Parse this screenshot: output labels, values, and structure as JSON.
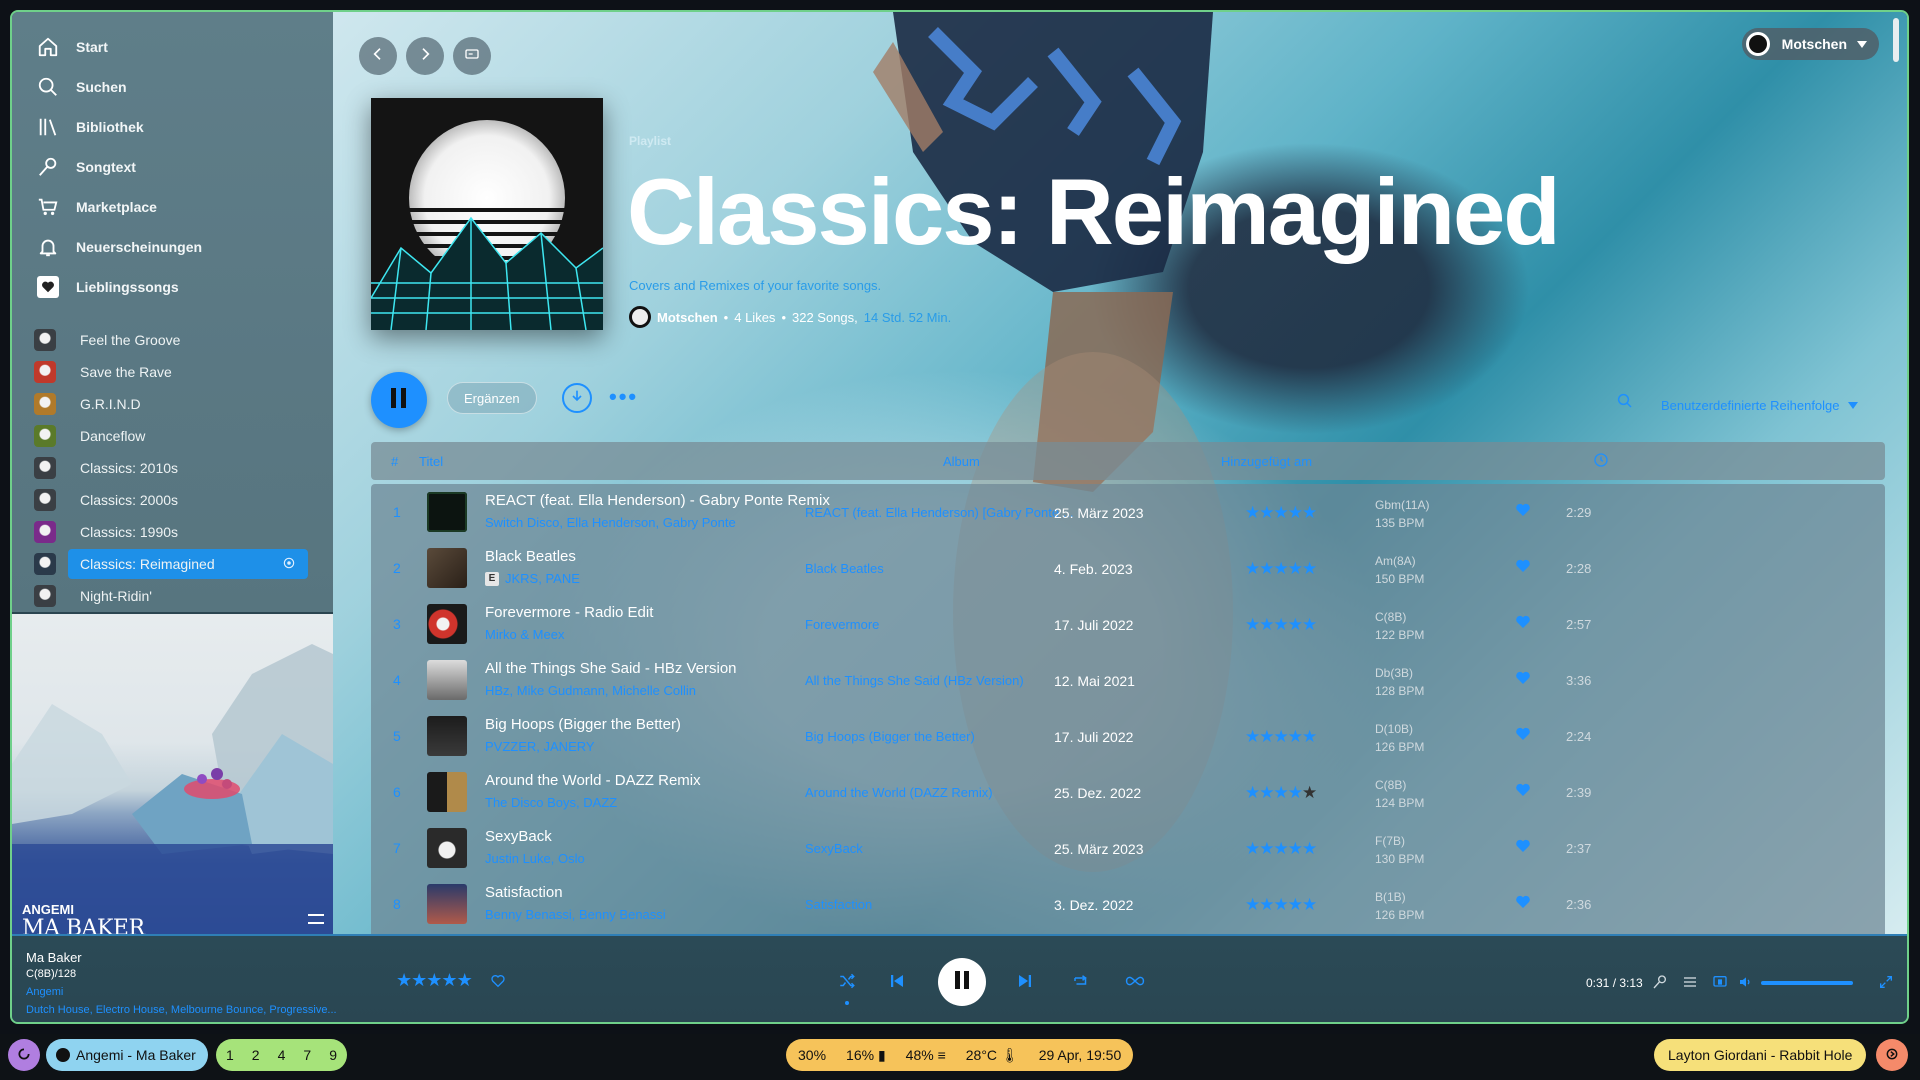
{
  "sidebar": {
    "nav": [
      {
        "label": "Start",
        "icon": "home-icon"
      },
      {
        "label": "Suchen",
        "icon": "search-icon"
      },
      {
        "label": "Bibliothek",
        "icon": "library-icon"
      },
      {
        "label": "Songtext",
        "icon": "microphone-icon"
      },
      {
        "label": "Marketplace",
        "icon": "cart-icon"
      },
      {
        "label": "Neuerscheinungen",
        "icon": "bell-icon"
      },
      {
        "label": "Lieblingssongs",
        "icon": "heart-icon"
      }
    ],
    "playlists": [
      {
        "label": "Feel the Groove"
      },
      {
        "label": "Save the Rave"
      },
      {
        "label": "G.R.I.N.D"
      },
      {
        "label": "Danceflow"
      },
      {
        "label": "Classics: 2010s"
      },
      {
        "label": "Classics: 2000s"
      },
      {
        "label": "Classics: 1990s"
      },
      {
        "label": "Classics: Reimagined",
        "active": true
      },
      {
        "label": "Night-Ridin'"
      }
    ],
    "art_artist": "ANGEMI",
    "art_title": "MA BAKER"
  },
  "header": {
    "user": "Motschen"
  },
  "playlist": {
    "type": "Playlist",
    "title": "Classics: Reimagined",
    "description": "Covers and Remixes of your favorite songs.",
    "owner": "Motschen",
    "likes": "4 Likes",
    "songs": "322 Songs,",
    "duration": "14 Std. 52 Min.",
    "add_label": "Ergänzen",
    "sort_label": "Benutzerdefinierte Reihenfolge"
  },
  "table": {
    "headers": {
      "num": "#",
      "title": "Titel",
      "album": "Album",
      "added": "Hinzugefügt am"
    },
    "rows": [
      {
        "num": "1",
        "title": "REACT (feat. Ella Henderson) - Gabry Ponte Remix",
        "artists": "Switch Disco, Ella Henderson, Gabry Ponte",
        "explicit": false,
        "album": "REACT (feat. Ella Henderson) [Gabry Ponte ...",
        "date": "25. März 2023",
        "rating": 5,
        "key": "Gbm(11A)",
        "bpm": "135 BPM",
        "duration": "2:29",
        "art": "react"
      },
      {
        "num": "2",
        "title": "Black Beatles",
        "artists": "JKRS, PANE",
        "explicit": true,
        "album": "Black Beatles",
        "date": "4. Feb. 2023",
        "rating": 5,
        "key": "Am(8A)",
        "bpm": "150 BPM",
        "duration": "2:28",
        "art": "beatles"
      },
      {
        "num": "3",
        "title": "Forevermore - Radio Edit",
        "artists": "Mirko & Meex",
        "explicit": false,
        "album": "Forevermore",
        "date": "17. Juli 2022",
        "rating": 5,
        "key": "C(8B)",
        "bpm": "122 BPM",
        "duration": "2:57",
        "art": "forever"
      },
      {
        "num": "4",
        "title": "All the Things She Said - HBz Version",
        "artists": "HBz, Mike Gudmann, Michelle Collin",
        "explicit": false,
        "album": "All the Things She Said (HBz Version)",
        "date": "12. Mai 2021",
        "rating": 0,
        "key": "Db(3B)",
        "bpm": "128 BPM",
        "duration": "3:36",
        "art": "things"
      },
      {
        "num": "5",
        "title": "Big Hoops (Bigger the Better)",
        "artists": "PVZZER, JANERY",
        "explicit": false,
        "album": "Big Hoops (Bigger the Better)",
        "date": "17. Juli 2022",
        "rating": 5,
        "key": "D(10B)",
        "bpm": "126 BPM",
        "duration": "2:24",
        "art": "hoops"
      },
      {
        "num": "6",
        "title": "Around the World - DAZZ Remix",
        "artists": "The Disco Boys, DAZZ",
        "explicit": false,
        "album": "Around the World (DAZZ Remix)",
        "date": "25. Dez. 2022",
        "rating": 4,
        "key": "C(8B)",
        "bpm": "124 BPM",
        "duration": "2:39",
        "art": "world"
      },
      {
        "num": "7",
        "title": "SexyBack",
        "artists": "Justin Luke, Oslo",
        "explicit": false,
        "album": "SexyBack",
        "date": "25. März 2023",
        "rating": 5,
        "key": "F(7B)",
        "bpm": "130 BPM",
        "duration": "2:37",
        "art": "sexy"
      },
      {
        "num": "8",
        "title": "Satisfaction",
        "artists": "Benny Benassi, Benny Benassi",
        "explicit": false,
        "album": "Satisfaction",
        "date": "3. Dez. 2022",
        "rating": 5,
        "key": "B(1B)",
        "bpm": "126 BPM",
        "duration": "2:36",
        "art": "satis"
      }
    ]
  },
  "player": {
    "title": "Ma Baker",
    "key": "C(8B)/128",
    "artist": "Angemi",
    "genres": "Dutch House, Electro House, Melbourne Bounce, Progressive...",
    "rating": 5,
    "time": "0:31 / 3:13",
    "volume": 1.0
  },
  "taskbar": {
    "now_playing": "Angemi - Ma Baker",
    "workspaces": [
      "1",
      "2",
      "4",
      "7",
      "9"
    ],
    "cpu": "30%",
    "battery": "16%",
    "memory": "48%",
    "temp": "28°C",
    "clock": "29 Apr, 19:50",
    "right_track": "Layton Giordani - Rabbit Hole"
  },
  "colors": {
    "accent": "#1e90ff",
    "border": "#6fd08a"
  }
}
